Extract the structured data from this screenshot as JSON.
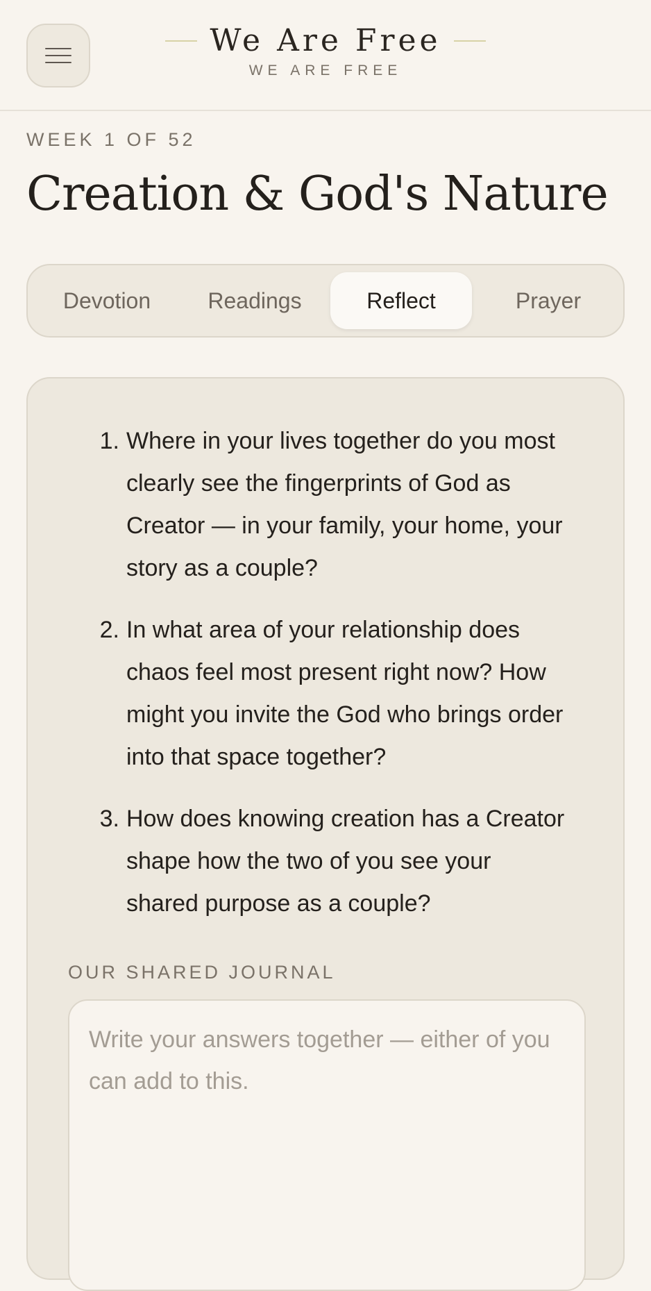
{
  "header": {
    "menu_icon": "hamburger-menu-icon",
    "brand_title": "We Are Free",
    "brand_subtitle": "WE ARE FREE"
  },
  "week_label": "WEEK 1 OF 52",
  "page_title": "Creation & God's Nature",
  "tabs": [
    {
      "label": "Devotion",
      "active": false
    },
    {
      "label": "Readings",
      "active": false
    },
    {
      "label": "Reflect",
      "active": true
    },
    {
      "label": "Prayer",
      "active": false
    }
  ],
  "reflect": {
    "questions": [
      {
        "number": "1.",
        "text": "Where in your lives together do you most clearly see the fingerprints of God as Creator — in your family, your home, your story as a couple?"
      },
      {
        "number": "2.",
        "text": "In what area of your relationship does chaos feel most present right now? How might you invite the God who brings order into that space together?"
      },
      {
        "number": "3.",
        "text": "How does knowing creation has a Creator shape how the two of you see your shared purpose as a couple?"
      }
    ],
    "journal_label": "OUR SHARED JOURNAL",
    "journal_placeholder": "Write your answers together — either of you can add to this.",
    "journal_value": ""
  },
  "colors": {
    "background": "#f8f4ee",
    "card": "#ede8de",
    "accent_line": "#d8d2a6",
    "text": "#24201c",
    "muted": "#7a7268"
  }
}
